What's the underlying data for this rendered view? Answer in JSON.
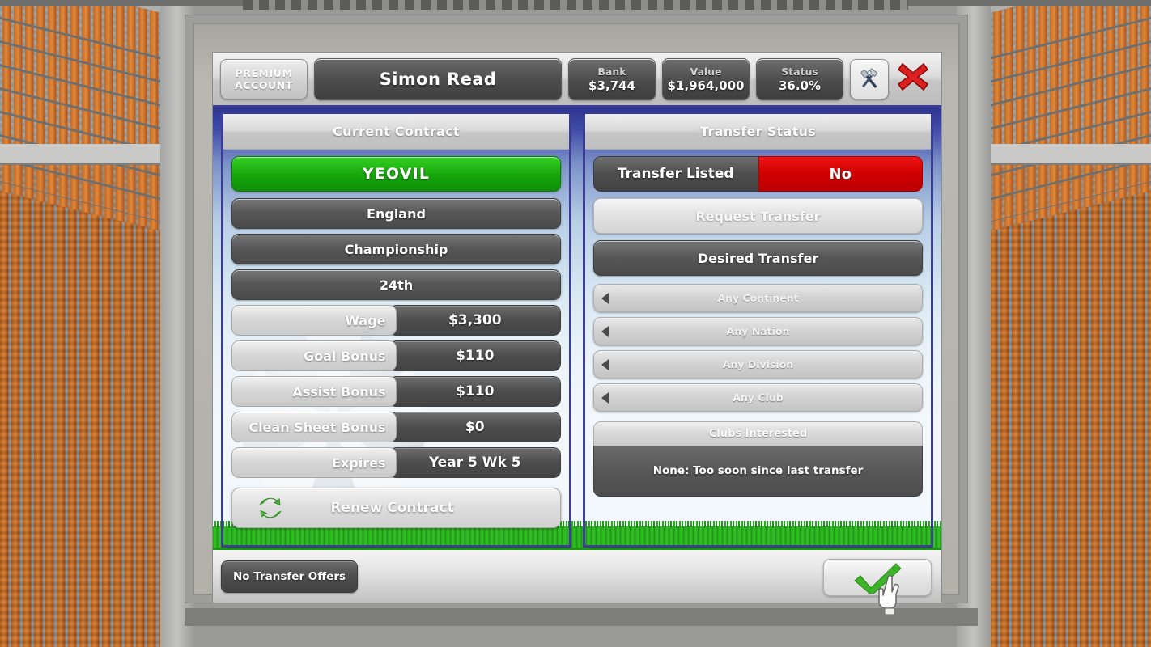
{
  "topbar": {
    "premium_line1": "PREMIUM",
    "premium_line2": "ACCOUNT",
    "player_name": "Simon Read",
    "stats": [
      {
        "label": "Bank",
        "value": "$3,744"
      },
      {
        "label": "Value",
        "value": "$1,964,000"
      },
      {
        "label": "Status",
        "value": "36.0%"
      }
    ],
    "tools_icon": "tools-icon",
    "close_icon": "close-icon"
  },
  "left_panel": {
    "title": "Current Contract",
    "club": "YEOVIL",
    "info_rows": [
      "England",
      "Championship",
      "24th"
    ],
    "detail_rows": [
      {
        "label": "Wage",
        "value": "$3,300"
      },
      {
        "label": "Goal Bonus",
        "value": "$110"
      },
      {
        "label": "Assist Bonus",
        "value": "$110"
      },
      {
        "label": "Clean Sheet Bonus",
        "value": "$0"
      },
      {
        "label": "Expires",
        "value": "Year 5 Wk 5"
      }
    ],
    "renew_label": "Renew Contract",
    "renew_icon": "recycle-icon"
  },
  "right_panel": {
    "title": "Transfer Status",
    "transfer_listed_label": "Transfer Listed",
    "transfer_listed_value": "No",
    "request_transfer_label": "Request Transfer",
    "desired_transfer_label": "Desired Transfer",
    "dropdowns": [
      "Any Continent",
      "Any Nation",
      "Any Division",
      "Any Club"
    ],
    "clubs_interested_title": "Clubs Interested",
    "clubs_interested_body": "None: Too soon since last transfer"
  },
  "bottombar": {
    "no_offers_label": "No Transfer Offers",
    "confirm_icon": "green-check-icon"
  },
  "colors": {
    "panel_border": "#3b3f91",
    "club_green": "#16a50b",
    "listed_red": "#cf0000",
    "grass_green": "#1d9413",
    "seat_orange": "#c4661f"
  }
}
